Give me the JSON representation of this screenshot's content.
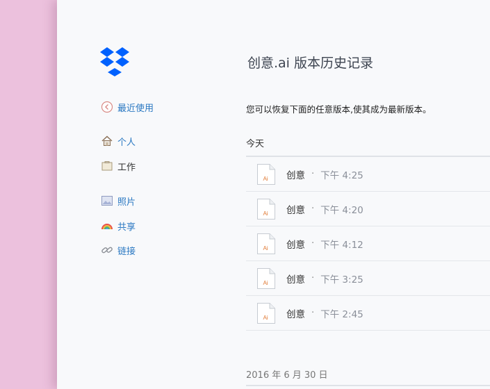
{
  "title": "创意.ai 版本历史记录",
  "description": "您可以恢复下面的任意版本,使其成为最新版本。",
  "sidebar": {
    "back": "最近使用",
    "personal": "个人",
    "work": "工作",
    "photos": "照片",
    "share": "共享",
    "links": "链接"
  },
  "sections": {
    "today": "今天",
    "older": "2016 年 6 月 30 日"
  },
  "versions": [
    {
      "name": "创意",
      "sep": "·",
      "time": "下午 4:25"
    },
    {
      "name": "创意",
      "sep": "·",
      "time": "下午 4:20"
    },
    {
      "name": "创意",
      "sep": "·",
      "time": "下午 4:12"
    },
    {
      "name": "创意",
      "sep": "·",
      "time": "下午 3:25"
    },
    {
      "name": "创意",
      "sep": "·",
      "time": "下午 2:45"
    }
  ],
  "file_icon_label": "Ai",
  "colors": {
    "accent": "#2a78c2",
    "brand": "#0061fe",
    "background": "#ecc1dd",
    "panel": "#f8f9fb"
  }
}
